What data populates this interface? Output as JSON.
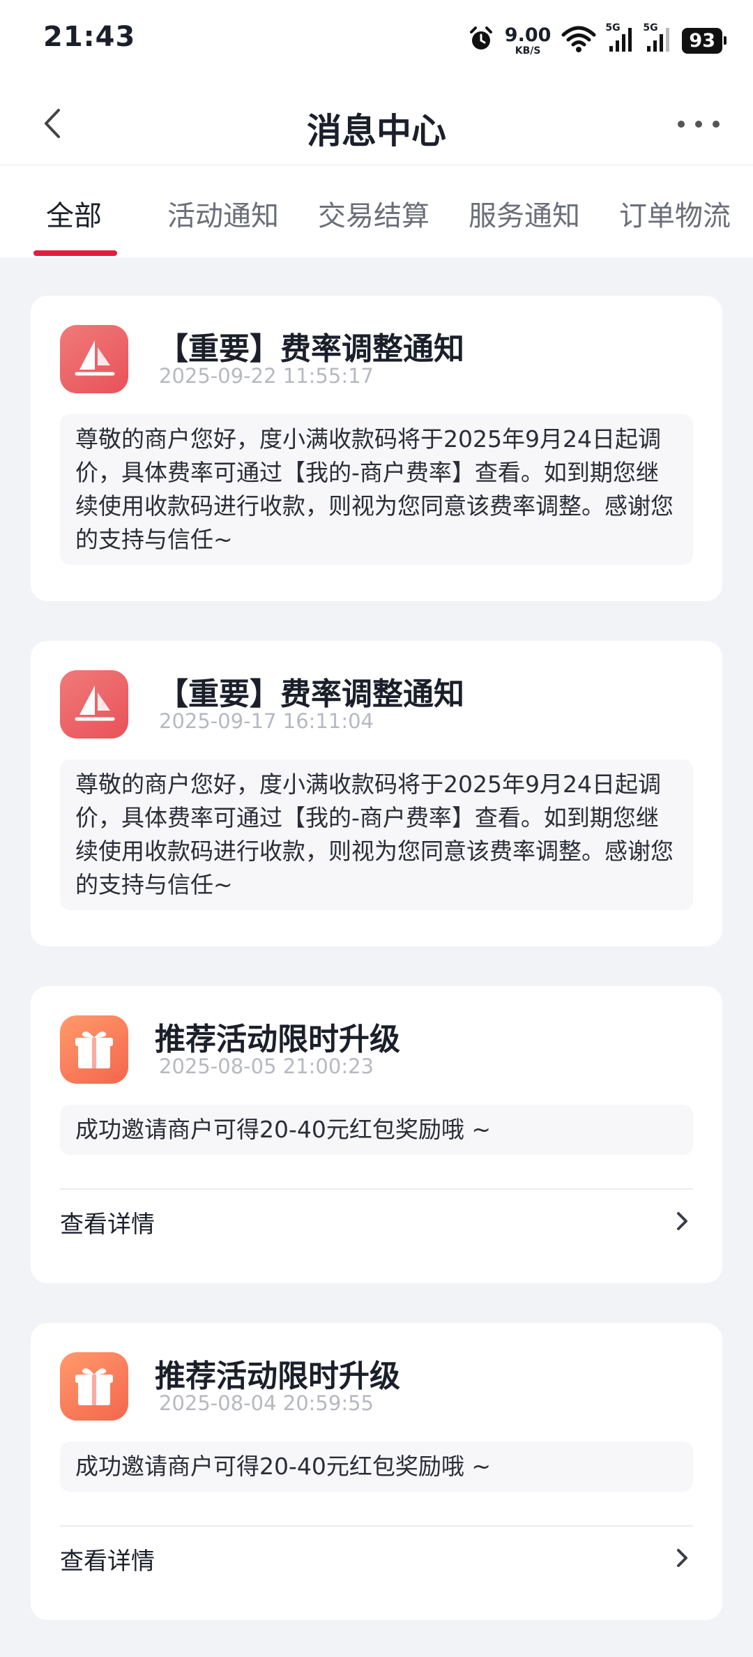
{
  "status_bar": {
    "time": "21:43",
    "net_speed": "9.00",
    "net_unit": "KB/S",
    "signal1": "5G",
    "signal2": "5G",
    "battery": "93"
  },
  "nav": {
    "title": "消息中心"
  },
  "tabs": [
    {
      "label": "全部",
      "active": true
    },
    {
      "label": "活动通知",
      "active": false
    },
    {
      "label": "交易结算",
      "active": false
    },
    {
      "label": "服务通知",
      "active": false
    },
    {
      "label": "订单物流",
      "active": false
    }
  ],
  "messages": [
    {
      "icon": "notice-boat-icon",
      "title": "【重要】费率调整通知",
      "time": "2025-09-22 11:55:17",
      "body": "尊敬的商户您好，度小满收款码将于2025年9月24日起调价，具体费率可通过【我的-商户费率】查看。如到期您继续使用收款码进行收款，则视为您同意该费率调整。感谢您的支持与信任~"
    },
    {
      "icon": "notice-boat-icon",
      "title": "【重要】费率调整通知",
      "time": "2025-09-17 16:11:04",
      "body": "尊敬的商户您好，度小满收款码将于2025年9月24日起调价，具体费率可通过【我的-商户费率】查看。如到期您继续使用收款码进行收款，则视为您同意该费率调整。感谢您的支持与信任~"
    },
    {
      "icon": "gift-icon",
      "title": "推荐活动限时升级",
      "time": "2025-08-05 21:00:23",
      "body": "成功邀请商户可得20-40元红包奖励哦 ~",
      "detail_label": "查看详情"
    },
    {
      "icon": "gift-icon",
      "title": "推荐活动限时升级",
      "time": "2025-08-04 20:59:55",
      "body": "成功邀请商户可得20-40元红包奖励哦 ~",
      "detail_label": "查看详情"
    }
  ],
  "colors": {
    "accent": "#e21c3c",
    "background": "#f2f3f7",
    "notice_icon": "#ec6367",
    "gift_icon": "#f8775a"
  }
}
